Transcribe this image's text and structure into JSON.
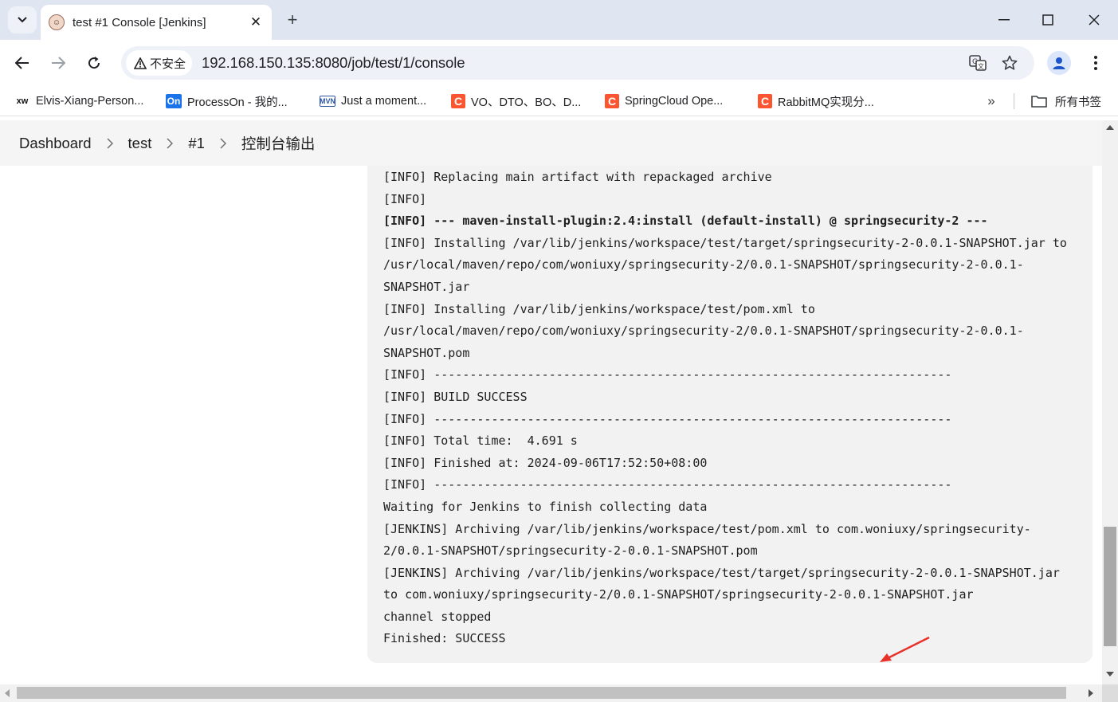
{
  "tab": {
    "title": "test #1 Console [Jenkins]"
  },
  "address": {
    "security_label": "不安全",
    "url": "192.168.150.135:8080/job/test/1/console"
  },
  "bookmarks": [
    {
      "icon": "xw",
      "label": "Elvis-Xiang-Person..."
    },
    {
      "icon": "On",
      "label": "ProcessOn - 我的..."
    },
    {
      "icon": "MVN",
      "label": "Just a moment..."
    },
    {
      "icon": "C",
      "label": "VO、DTO、BO、D..."
    },
    {
      "icon": "C",
      "label": "SpringCloud Ope..."
    },
    {
      "icon": "C",
      "label": "RabbitMQ实现分..."
    }
  ],
  "bookmarks_all": "所有书签",
  "breadcrumb": [
    "Dashboard",
    "test",
    "#1",
    "控制台输出"
  ],
  "console_lines": [
    "[INFO] Replacing main artifact with repackaged archive",
    "[INFO]",
    "[INFO] --- maven-install-plugin:2.4:install (default-install) @ springsecurity-2 ---",
    "[INFO] Installing /var/lib/jenkins/workspace/test/target/springsecurity-2-0.0.1-SNAPSHOT.jar to",
    "/usr/local/maven/repo/com/woniuxy/springsecurity-2/0.0.1-SNAPSHOT/springsecurity-2-0.0.1-",
    "SNAPSHOT.jar",
    "[INFO] Installing /var/lib/jenkins/workspace/test/pom.xml to",
    "/usr/local/maven/repo/com/woniuxy/springsecurity-2/0.0.1-SNAPSHOT/springsecurity-2-0.0.1-",
    "SNAPSHOT.pom",
    "[INFO] ------------------------------------------------------------------------",
    "[INFO] BUILD SUCCESS",
    "[INFO] ------------------------------------------------------------------------",
    "[INFO] Total time:  4.691 s",
    "[INFO] Finished at: 2024-09-06T17:52:50+08:00",
    "[INFO] ------------------------------------------------------------------------",
    "Waiting for Jenkins to finish collecting data",
    "[JENKINS] Archiving /var/lib/jenkins/workspace/test/pom.xml to com.woniuxy/springsecurity-",
    "2/0.0.1-SNAPSHOT/springsecurity-2-0.0.1-SNAPSHOT.pom",
    "[JENKINS] Archiving /var/lib/jenkins/workspace/test/target/springsecurity-2-0.0.1-SNAPSHOT.jar",
    "to com.woniuxy/springsecurity-2/0.0.1-SNAPSHOT/springsecurity-2-0.0.1-SNAPSHOT.jar",
    "channel stopped",
    "Finished: SUCCESS"
  ],
  "colors": {
    "annotation_arrow": "#e8312a",
    "tabstrip": "#dfe6f1",
    "console_bg": "#f2f2f2"
  }
}
